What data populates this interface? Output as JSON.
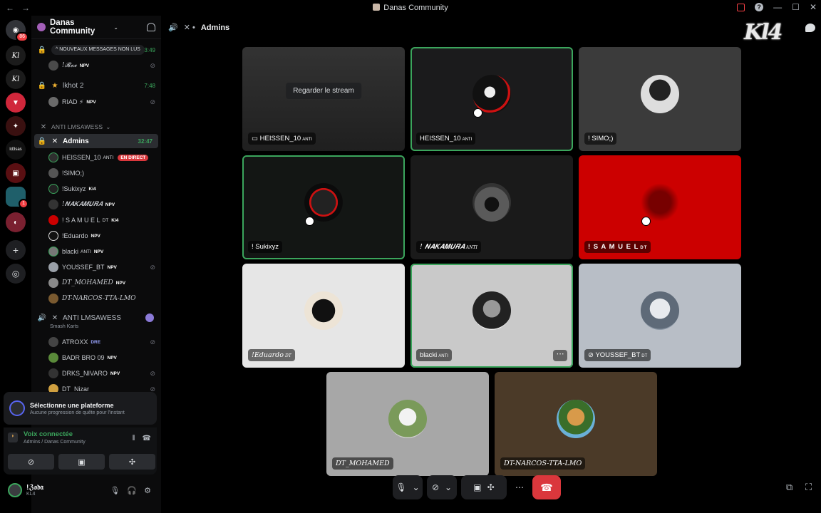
{
  "window": {
    "title": "Danas Community"
  },
  "rail": {
    "home_badge": "86",
    "server_badge": "1"
  },
  "sidebar": {
    "guild_name": "Danas Community",
    "new_messages": "NOUVEAUX MESSAGES NON LUS",
    "channels": [
      {
        "name": "!𝓡𝓮𝔁",
        "tag": "NPV",
        "time": "3:49"
      },
      {
        "name": "lkhot 2",
        "time": "7:48"
      },
      {
        "name": "RIAD ⚡",
        "tag": "NPV"
      }
    ],
    "category": "ANTI LMSAWESS",
    "active_channel": {
      "name": "Admins",
      "time": "32:47"
    },
    "members": [
      {
        "name": "HEISSEN_10",
        "tag": "ANTI",
        "live": "EN DIRECT"
      },
      {
        "name": "!SIMO;)"
      },
      {
        "name": "!Sukixyz",
        "tag": "Ki4"
      },
      {
        "name": "!𝑵𝑨𝑲𝑨𝑴𝑼𝑹𝑨",
        "tag": "NPV"
      },
      {
        "name": "! S A M U E L",
        "tag": "DT",
        "tag2": "Ki4"
      },
      {
        "name": "!Eduardo",
        "tag": "NPV"
      },
      {
        "name": "blacki",
        "tag": "ANTI",
        "tag2": "NPV"
      },
      {
        "name": "YOUSSEF_BT",
        "tag": "NPV"
      },
      {
        "name": "DT_MOHAMED",
        "tag": "NPV"
      },
      {
        "name": "DT-NARCOS-TTA-LMO"
      }
    ],
    "second_channel": {
      "name": "ANTI LMSAWESS",
      "sub": "Smash Karts"
    },
    "members2": [
      {
        "name": "ATROXX",
        "tag": "DRE"
      },
      {
        "name": "BADR BRO 09",
        "tag": "NPV"
      },
      {
        "name": "DRKS_NIVARO",
        "tag": "NPV"
      },
      {
        "name": "DT_Nizar"
      }
    ]
  },
  "quest": {
    "title": "Sélectionne une plateforme",
    "subtitle": "Aucune progression de quête pour l'instant"
  },
  "voice": {
    "status": "Voix connectée",
    "location": "Admins / Danas Community"
  },
  "user": {
    "name": "!ℨ𝔬𝔡𝔞",
    "status": "KL4"
  },
  "main": {
    "channel": "Admins",
    "logo_text": "Kl4"
  },
  "tiles": [
    {
      "name": "HEISSEN_10",
      "tag": "ANTI",
      "watch_label": "Regarder le stream",
      "bg": "#2a2a2a"
    },
    {
      "name": "HEISSEN_10",
      "tag": "ANTI",
      "bg": "#1a1a1b"
    },
    {
      "name": "! SIMO;)",
      "bg": "#3a3a3a"
    },
    {
      "name": "! Sukixyz",
      "bg": "#141815"
    },
    {
      "name": "! 𝑵𝑨𝑲𝑨𝑴𝑼𝑹𝑨",
      "tag": "ANTI",
      "bg": "#1a1a1a"
    },
    {
      "name": "! S A M U E L",
      "tag": "DT",
      "bg": "#cc0000"
    },
    {
      "name": "!Eduardo",
      "tag": "DT",
      "bg": "#e6e6e6"
    },
    {
      "name": "blacki",
      "tag": "ANTI",
      "bg": "#c9c9c9"
    },
    {
      "name": "YOUSSEF_BT",
      "tag": "DT",
      "bg": "#b8bec6"
    },
    {
      "name": "DT_MOHAMED",
      "bg": "#a7a7a7"
    },
    {
      "name": "DT-NARCOS-TTA-LMO",
      "bg": "#4b3a28"
    }
  ],
  "colors": {
    "accent_green": "#3ba55c",
    "danger": "#da373c",
    "brand": "#5865f2"
  }
}
